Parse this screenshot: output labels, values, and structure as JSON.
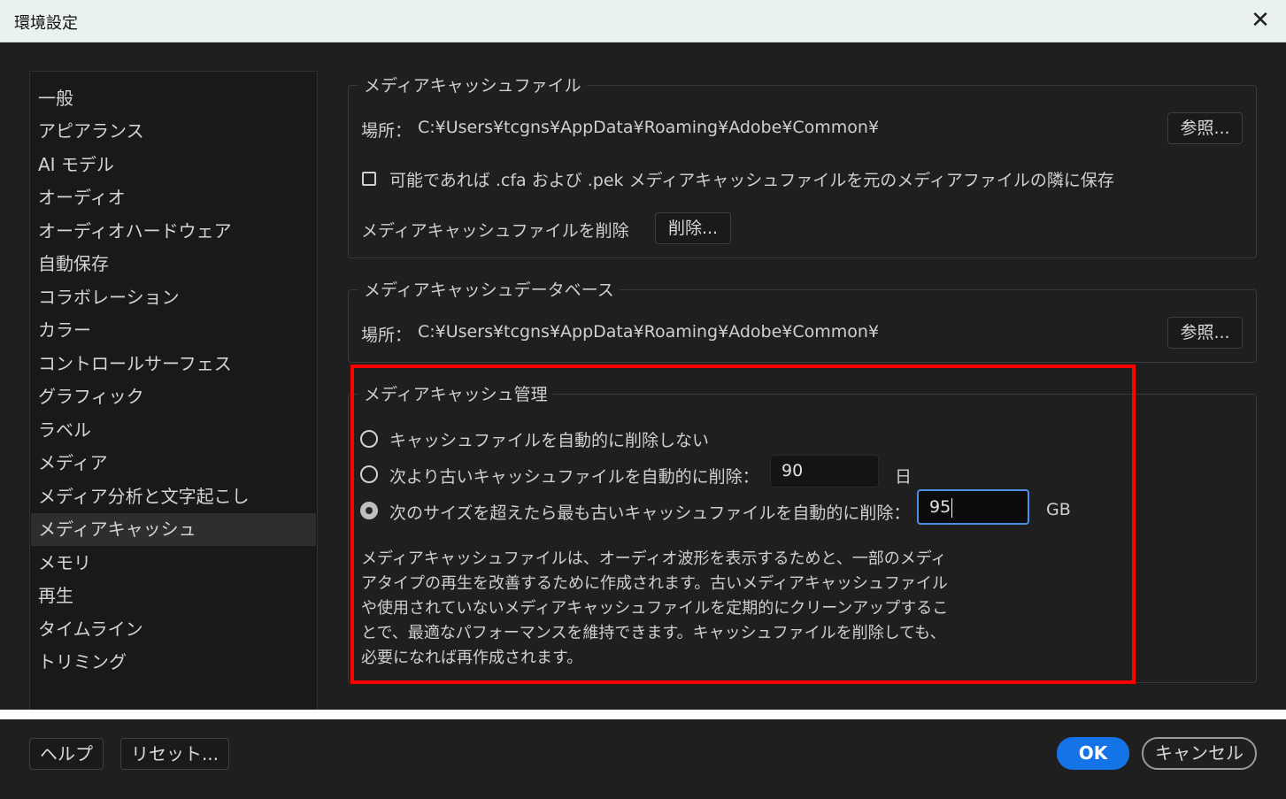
{
  "window": {
    "title": "環境設定",
    "close_symbol": "✕"
  },
  "sidebar": {
    "items": [
      {
        "label": "一般"
      },
      {
        "label": "アピアランス"
      },
      {
        "label": "AI モデル"
      },
      {
        "label": "オーディオ"
      },
      {
        "label": "オーディオハードウェア"
      },
      {
        "label": "自動保存"
      },
      {
        "label": "コラボレーション"
      },
      {
        "label": "カラー"
      },
      {
        "label": "コントロールサーフェス"
      },
      {
        "label": "グラフィック"
      },
      {
        "label": "ラベル"
      },
      {
        "label": "メディア"
      },
      {
        "label": "メディア分析と文字起こし"
      },
      {
        "label": "メディアキャッシュ",
        "selected": true
      },
      {
        "label": "メモリ"
      },
      {
        "label": "再生"
      },
      {
        "label": "タイムライン"
      },
      {
        "label": "トリミング"
      }
    ]
  },
  "cache_files": {
    "title": "メディアキャッシュファイル",
    "location_label": "場所：",
    "location_path": "C:¥Users¥tcgns¥AppData¥Roaming¥Adobe¥Common¥",
    "browse_label": "参照...",
    "save_next_label": "可能であれば .cfa および .pek メディアキャッシュファイルを元のメディアファイルの隣に保存",
    "save_next_checked": false,
    "delete_label": "メディアキャッシュファイルを削除",
    "delete_button": "削除..."
  },
  "cache_db": {
    "title": "メディアキャッシュデータベース",
    "location_label": "場所：",
    "location_path": "C:¥Users¥tcgns¥AppData¥Roaming¥Adobe¥Common¥",
    "browse_label": "参照..."
  },
  "cache_mgmt": {
    "title": "メディアキャッシュ管理",
    "option_never": "キャッシュファイルを自動的に削除しない",
    "option_older": "次より古いキャッシュファイルを自動的に削除：",
    "older_value": "90",
    "older_unit": "日",
    "option_size": "次のサイズを超えたら最も古いキャッシュファイルを自動的に削除：",
    "size_value": "95",
    "size_unit": "GB",
    "selected_option": "size",
    "description": "メディアキャッシュファイルは、オーディオ波形を表示するためと、一部のメディアタイプの再生を改善するために作成されます。古いメディアキャッシュファイルや使用されていないメディアキャッシュファイルを定期的にクリーンアップすることで、最適なパフォーマンスを維持できます。キャッシュファイルを削除しても、必要になれば再作成されます。"
  },
  "footer": {
    "help": "ヘルプ",
    "reset": "リセット...",
    "ok": "OK",
    "cancel": "キャンセル"
  },
  "colors": {
    "accent": "#1473e6",
    "highlight_box": "#ff0000",
    "background": "#1f1f1f"
  }
}
